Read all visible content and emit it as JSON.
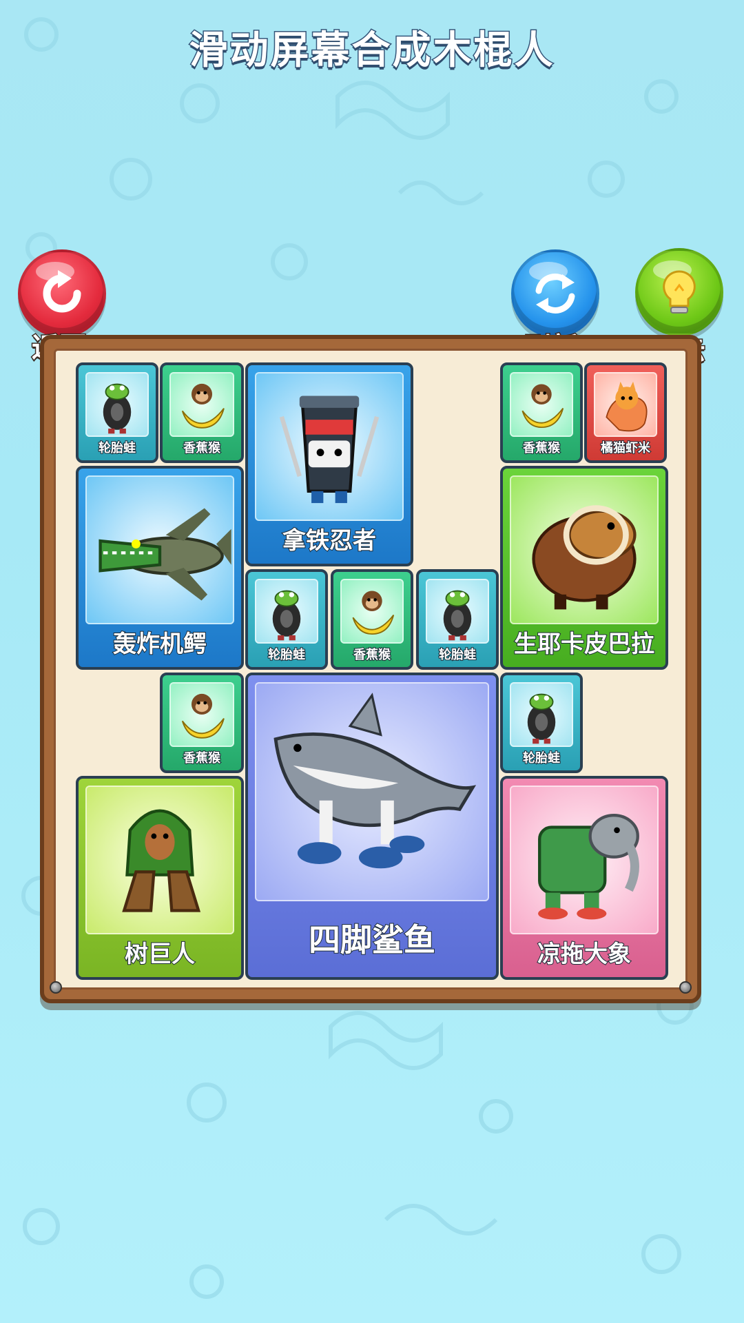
{
  "title": "滑动屏幕合成木棍人",
  "buttons": {
    "back": {
      "label": "返回",
      "icon": "restart-arrow-icon",
      "color": "#e42b3d"
    },
    "refresh": {
      "label": "刷新",
      "icon": "refresh-arrows-icon",
      "color": "#2593ec"
    },
    "hint": {
      "label": "提示",
      "icon": "lightbulb-icon",
      "color": "#6ec817"
    }
  },
  "tiles": [
    {
      "label": "轮胎蛙"
    },
    {
      "label": "香蕉猴"
    },
    {
      "label": "拿铁忍者"
    },
    {
      "label": "香蕉猴"
    },
    {
      "label": "橘猫虾米"
    },
    {
      "label": "轰炸机鳄"
    },
    {
      "label": "生耶卡皮巴拉"
    },
    {
      "label": "轮胎蛙"
    },
    {
      "label": "香蕉猴"
    },
    {
      "label": "轮胎蛙"
    },
    {
      "label": "香蕉猴"
    },
    {
      "label": "四脚鲨鱼"
    },
    {
      "label": "轮胎蛙"
    },
    {
      "label": "树巨人"
    },
    {
      "label": "凉拖大象"
    }
  ]
}
